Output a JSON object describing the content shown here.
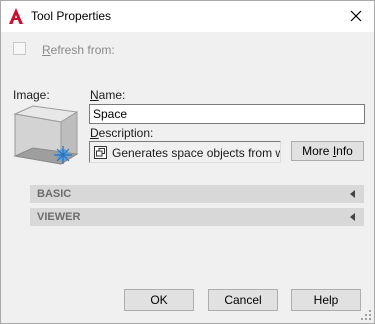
{
  "window": {
    "title": "Tool Properties"
  },
  "refresh": {
    "label_first": "R",
    "label_rest": "efresh from:"
  },
  "image": {
    "label": "Image:"
  },
  "name": {
    "label_first": "N",
    "label_rest": "ame:",
    "value": "Space"
  },
  "description": {
    "label_first": "D",
    "label_rest": "escription:",
    "value": "Generates space objects from w"
  },
  "more_info": {
    "label_first": "More ",
    "label_accel": "I",
    "label_rest": "nfo"
  },
  "sections": [
    {
      "label": "BASIC",
      "icon": "triangle-left-icon"
    },
    {
      "label": "VIEWER",
      "icon": "triangle-left-icon"
    }
  ],
  "buttons": {
    "ok": "OK",
    "cancel": "Cancel",
    "help": "Help"
  },
  "colors": {
    "app_icon": "#c8102e",
    "section_bg": "#d8d8d8",
    "window_bg": "#f0f0f0"
  }
}
